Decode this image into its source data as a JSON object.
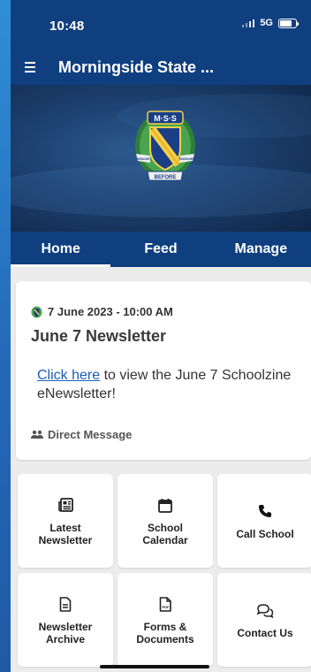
{
  "status_bar": {
    "time": "10:48",
    "network": "5G"
  },
  "app_bar": {
    "title": "Morningside State ..."
  },
  "banner": {
    "crest_text_top": "M·S·S",
    "crest_text_left": "HONOUR",
    "crest_text_right": "HONOURS",
    "crest_text_bottom": "BEFORE"
  },
  "tabs": [
    {
      "label": "Home",
      "active": true
    },
    {
      "label": "Feed",
      "active": false
    },
    {
      "label": "Manage",
      "active": false
    }
  ],
  "post": {
    "date": "7 June 2023 - 10:00 AM",
    "headline": "June 7 Newsletter",
    "link_text": "Click here",
    "body_text": " to view the June 7 Schoolzine eNewsletter!",
    "footer": "Direct Message"
  },
  "tiles": [
    {
      "label": "Latest\nNewsletter",
      "icon": "newspaper-icon"
    },
    {
      "label": "School\nCalendar",
      "icon": "calendar-icon"
    },
    {
      "label": "Call School",
      "icon": "phone-icon"
    },
    {
      "label": "Newsletter\nArchive",
      "icon": "document-icon"
    },
    {
      "label": "Forms &\nDocuments",
      "icon": "pdf-icon"
    },
    {
      "label": "Contact Us",
      "icon": "chat-icon"
    }
  ],
  "colors": {
    "primary": "#0f3f7f",
    "background": "#ececec",
    "link": "#1a5fb8"
  }
}
